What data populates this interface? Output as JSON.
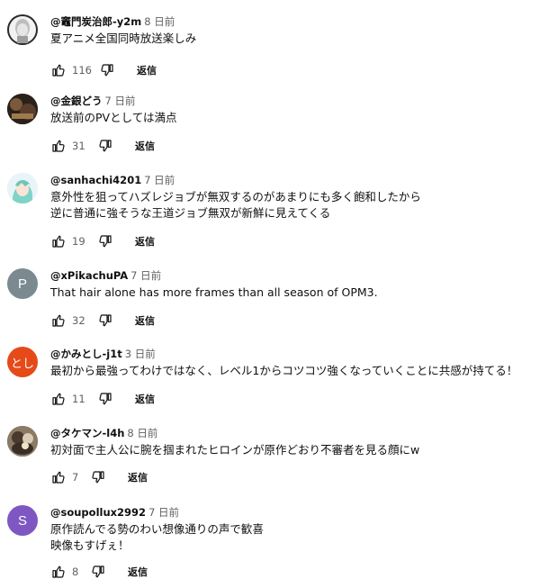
{
  "comments": [
    {
      "author": "@竈門炭治郎-y2m",
      "time": "8 日前",
      "lines": [
        "夏アニメ全国同時放送楽しみ"
      ],
      "likes": "116",
      "reply": "返信",
      "avatar_type": "image",
      "avatar_color": "#dcdcdc"
    },
    {
      "author": "@金銀どう",
      "time": "7 日前",
      "lines": [
        "放送前のPVとしては満点"
      ],
      "likes": "31",
      "reply": "返信",
      "avatar_type": "image",
      "avatar_color": "#3a2b22"
    },
    {
      "author": "@sanhachi4201",
      "time": "7 日前",
      "lines": [
        "意外性を狙ってハズレジョブが無双するのがあまりにも多く飽和したから",
        "逆に普通に強そうな王道ジョブ無双が新鮮に見えてくる"
      ],
      "likes": "19",
      "reply": "返信",
      "avatar_type": "image",
      "avatar_color": "#cfe9f3"
    },
    {
      "author": "@xPikachuPA",
      "time": "7 日前",
      "lines": [
        "That hair alone has more frames than all season of OPM3."
      ],
      "likes": "32",
      "reply": "返信",
      "avatar_type": "letter",
      "avatar_letter": "P",
      "avatar_color": "#7b8a91"
    },
    {
      "author": "@かみとし-j1t",
      "time": "3 日前",
      "lines": [
        "最初から最強ってわけではなく、レベル1からコツコツ強くなっていくことに共感が持てる！"
      ],
      "likes": "11",
      "reply": "返信",
      "avatar_type": "letter",
      "avatar_letter": "とし",
      "avatar_color": "#e64a19"
    },
    {
      "author": "@タケマン-l4h",
      "time": "8 日前",
      "lines": [
        "初対面で主人公に腕を掴まれたヒロインが原作どおり不審者を見る顔にw"
      ],
      "likes": "7",
      "reply": "返信",
      "avatar_type": "image",
      "avatar_color": "#6b5a4a"
    },
    {
      "author": "@soupollux2992",
      "time": "7 日前",
      "lines": [
        "原作読んでる勢のわい想像通りの声で歓喜",
        "映像もすげぇ！"
      ],
      "likes": "8",
      "reply": "返信",
      "avatar_type": "letter",
      "avatar_letter": "S",
      "avatar_color": "#7e57c2"
    }
  ]
}
